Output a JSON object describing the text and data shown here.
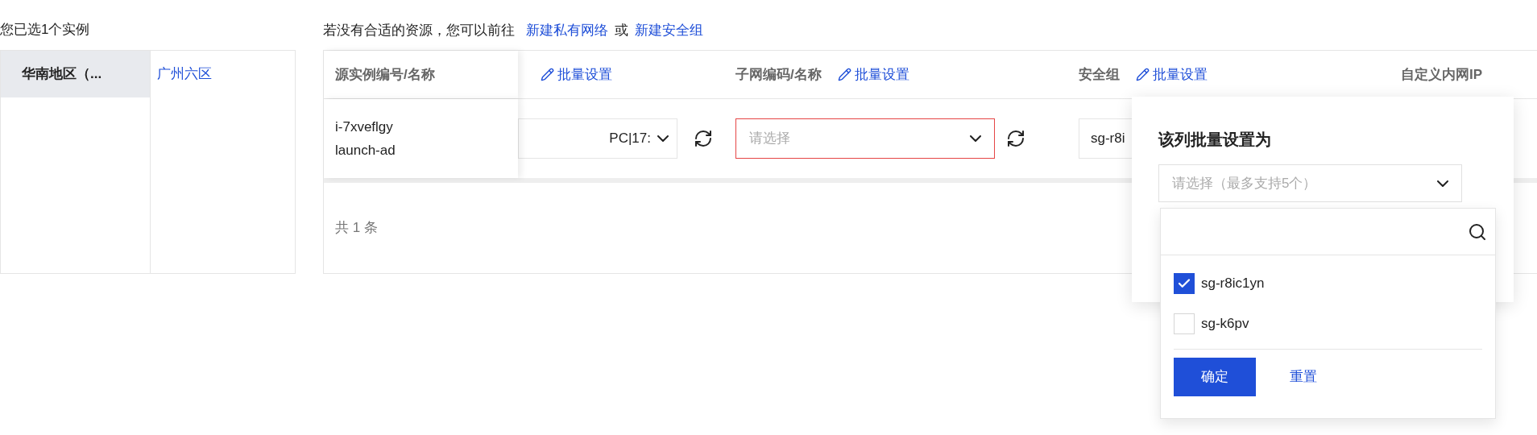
{
  "selection_summary": "您已选1个实例",
  "regions": [
    {
      "label": "华南地区（...",
      "selected": true
    }
  ],
  "zones": [
    {
      "label": "广州六区",
      "selected": true
    }
  ],
  "hint": {
    "text": "若没有合适的资源，您可以前往",
    "links": [
      "新建私有网络",
      "新建安全组"
    ],
    "separator": "或"
  },
  "table": {
    "columns": [
      {
        "label": "源实例编号/名称"
      },
      {
        "batch_action": "批量设置"
      },
      {
        "label": "子网编码/名称",
        "batch_action": "批量设置"
      },
      {
        "label": "安全组",
        "batch_action": "批量设置"
      },
      {
        "label": "自定义内网IP"
      }
    ],
    "rows": [
      {
        "instance_id": "i-7xveflgy",
        "instance_name": "launch-ad",
        "vpc": {
          "value": "PC|17:"
        },
        "subnet": {
          "placeholder": "请选择",
          "error": true
        },
        "security_group": {
          "value": "sg-r8i"
        }
      }
    ],
    "footer": "共 1 条"
  },
  "popover": {
    "title": "该列批量设置为",
    "select": {
      "placeholder": "请选择（最多支持5个）"
    },
    "options": [
      {
        "label": "sg-r8ic1yn",
        "checked": true
      },
      {
        "label": "sg-k6pv",
        "checked": false
      }
    ],
    "confirm": "确定",
    "reset": "重置"
  }
}
